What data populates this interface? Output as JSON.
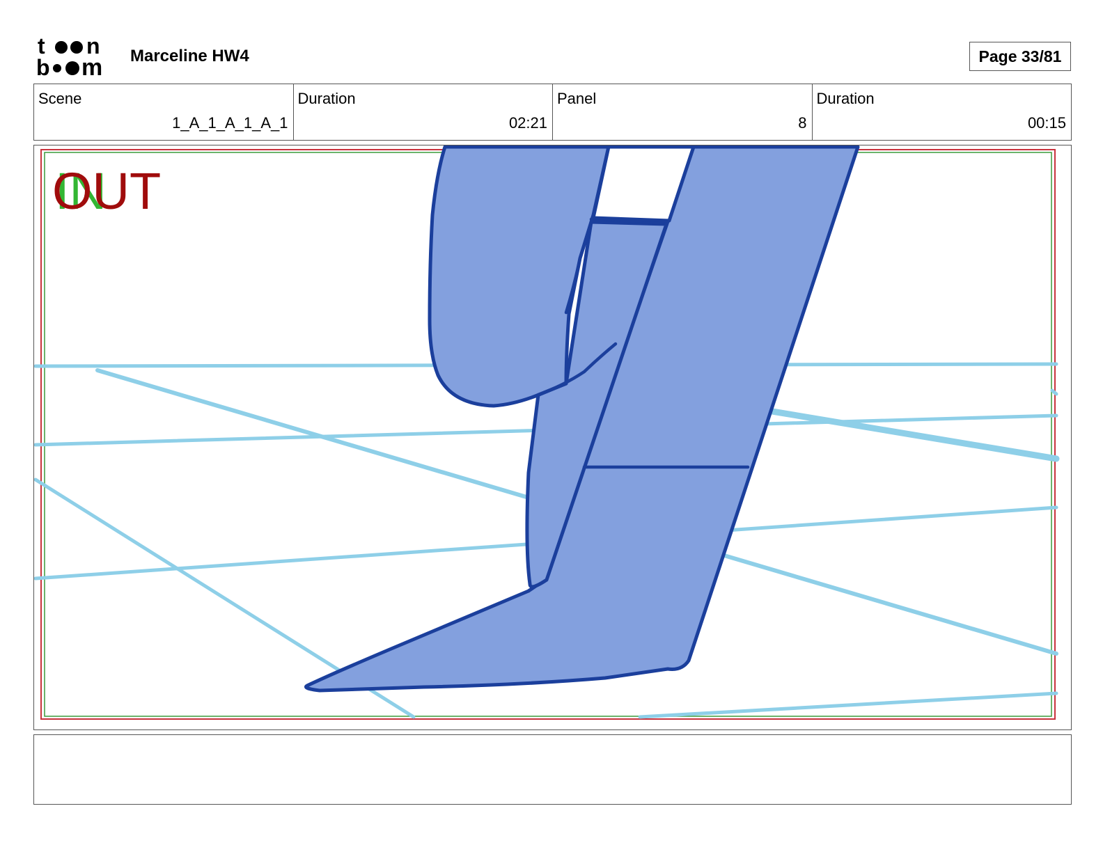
{
  "header": {
    "logo_text": "toon boom",
    "project_title": "Marceline HW4",
    "page_label": "Page 33/81"
  },
  "info": {
    "scene_label": "Scene",
    "scene_value": "1_A_1_A_1_A_1",
    "scene_duration_label": "Duration",
    "scene_duration_value": "02:21",
    "panel_label": "Panel",
    "panel_value": "8",
    "panel_duration_label": "Duration",
    "panel_duration_value": "00:15"
  },
  "panel": {
    "in_marker": "IN",
    "out_marker": "OUT",
    "colors": {
      "floor_lines": "#8ecfe8",
      "leg_fill": "#83a0de",
      "leg_outline": "#1b3f9c",
      "safe_frame_red": "#c8323c",
      "safe_frame_green": "#3a9a3a"
    }
  },
  "notes": {
    "text": ""
  }
}
